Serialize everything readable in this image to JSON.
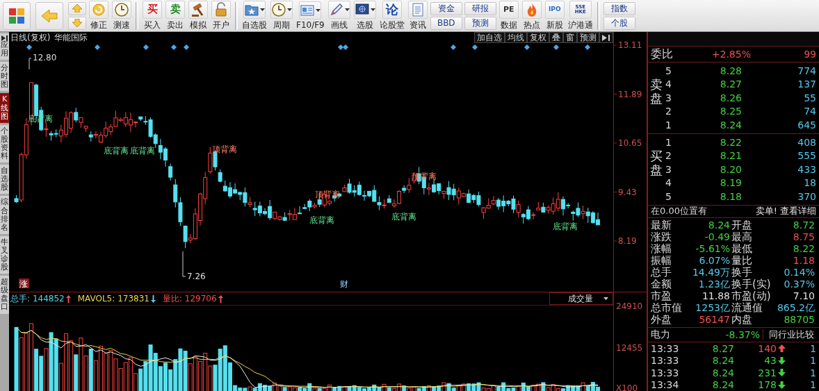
{
  "toolbar": [
    {
      "kind": "tile"
    },
    {
      "kind": "tile"
    },
    {
      "kind": "arrows"
    },
    {
      "kind": "button",
      "label": "修正"
    },
    {
      "kind": "button",
      "label": "测速"
    },
    {
      "kind": "separator"
    },
    {
      "kind": "button",
      "label": "买入",
      "glyph": "买"
    },
    {
      "kind": "button",
      "label": "卖出",
      "glyph": "卖"
    },
    {
      "kind": "button",
      "label": "模拟"
    },
    {
      "kind": "button",
      "label": "开户"
    },
    {
      "kind": "separator"
    },
    {
      "kind": "dropdown",
      "label": "自选股"
    },
    {
      "kind": "dropdown",
      "label": "周期"
    },
    {
      "kind": "dropdown",
      "label": "F10/F9"
    },
    {
      "kind": "dropdown",
      "label": "画线"
    },
    {
      "kind": "dropdown",
      "label": "选股"
    },
    {
      "kind": "button",
      "label": "论股堂",
      "glyph": "论"
    },
    {
      "kind": "button",
      "label": "资讯"
    },
    {
      "kind": "pair",
      "labels": [
        "资金",
        "BBD"
      ]
    },
    {
      "kind": "pair",
      "labels": [
        "研报",
        "预测"
      ]
    },
    {
      "kind": "button",
      "label": "数据",
      "glyph": "PE"
    },
    {
      "kind": "button",
      "label": "热点"
    },
    {
      "kind": "button",
      "label": "新股",
      "glyph": "IPO"
    },
    {
      "kind": "button",
      "label": "沪港通",
      "glyph": "SSE HKE"
    },
    {
      "kind": "separator"
    },
    {
      "kind": "pair",
      "labels": [
        "指数",
        "个股"
      ]
    }
  ],
  "side_tabs": [
    {
      "label": "应用",
      "selected": false
    },
    {
      "label": "分时图",
      "selected": false
    },
    {
      "label": "K线图",
      "selected": true
    },
    {
      "label": "个股资料",
      "selected": false
    },
    {
      "label": "自选股",
      "selected": false
    },
    {
      "label": "综合排名",
      "selected": false
    },
    {
      "label": "牛叉诊股",
      "selected": false
    },
    {
      "label": "超级盘口",
      "selected": false
    }
  ],
  "chart": {
    "period": "日线(复权)",
    "stock_name": "华能国际",
    "buttons": [
      "加自选",
      "均线",
      "复权",
      "叠",
      "窗",
      "预测"
    ],
    "price_ticks": [
      "13.11",
      "11.89",
      "10.65",
      "9.43",
      "8.19"
    ],
    "high_label": "12.80",
    "low_label": "7.26",
    "signals": [
      {
        "text": "底背离",
        "kind": "bottom"
      },
      {
        "text": "底背离",
        "kind": "bottom"
      },
      {
        "text": "底背离",
        "kind": "bottom"
      },
      {
        "text": "顶背离",
        "kind": "top"
      },
      {
        "text": "顶背离",
        "kind": "top"
      },
      {
        "text": "底背离",
        "kind": "bottom"
      },
      {
        "text": "底背离",
        "kind": "bottom"
      },
      {
        "text": "顶背离",
        "kind": "top"
      },
      {
        "text": "底背离",
        "kind": "bottom"
      }
    ],
    "tags": [
      {
        "text": "涨",
        "kind": "badge"
      },
      {
        "text": "财",
        "kind": "plain"
      }
    ]
  },
  "volume": {
    "readings": [
      {
        "label": "总手:",
        "value": "144852",
        "kind": "up",
        "color": "#55d8e8"
      },
      {
        "label": "MAVOL5:",
        "value": "173831",
        "kind": "down",
        "color": "#e8d850"
      },
      {
        "label": "量比:",
        "value": "129706",
        "kind": "up",
        "color": "#f05050"
      }
    ],
    "indicator": "成交量",
    "axis_ticks": [
      "24910",
      "12455",
      "X100"
    ]
  },
  "quote": {
    "ratio_label": "委比",
    "ratio_value": "+2.85%",
    "ratio_diff": "99",
    "asks_label": "卖盘",
    "asks": [
      {
        "level": "5",
        "price": "8.28",
        "volume": "774"
      },
      {
        "level": "4",
        "price": "8.27",
        "volume": "137"
      },
      {
        "level": "3",
        "price": "8.26",
        "volume": "55"
      },
      {
        "level": "2",
        "price": "8.25",
        "volume": "74"
      },
      {
        "level": "1",
        "price": "8.24",
        "volume": "645"
      }
    ],
    "bids_label": "买盘",
    "bids": [
      {
        "level": "1",
        "price": "8.22",
        "volume": "408"
      },
      {
        "level": "2",
        "price": "8.21",
        "volume": "555"
      },
      {
        "level": "3",
        "price": "8.20",
        "volume": "433"
      },
      {
        "level": "4",
        "price": "8.19",
        "volume": "18"
      },
      {
        "level": "5",
        "price": "8.18",
        "volume": "370"
      }
    ],
    "note": "在0.00位置有",
    "note_link": "卖单! 查看详细",
    "stats": [
      {
        "label": "最新",
        "value": "8.24",
        "color": "#44d044"
      },
      {
        "label": "开盘",
        "value": "8.72",
        "color": "#44d044"
      },
      {
        "label": "涨跌",
        "value": "-0.49",
        "color": "#44d044"
      },
      {
        "label": "最高",
        "value": "8.75",
        "color": "#f05050"
      },
      {
        "label": "涨幅",
        "value": "-5.61%",
        "color": "#44d044"
      },
      {
        "label": "最低",
        "value": "8.22",
        "color": "#44d044"
      },
      {
        "label": "振幅",
        "value": "6.07%",
        "color": "#55c8e8"
      },
      {
        "label": "量比",
        "value": "1.18",
        "color": "#f05050"
      },
      {
        "label": "总手",
        "value": "14.49万",
        "color": "#55c8e8"
      },
      {
        "label": "换手",
        "value": "0.14%",
        "color": "#55c8e8"
      },
      {
        "label": "金额",
        "value": "1.23亿",
        "color": "#55c8e8"
      },
      {
        "label": "换手(实)",
        "value": "0.37%",
        "color": "#55c8e8"
      },
      {
        "label": "市盈",
        "value": "11.88",
        "color": "#e0e0e0"
      },
      {
        "label": "市盈(动)",
        "value": "7.10",
        "color": "#e0e0e0"
      },
      {
        "label": "总市值",
        "value": "1253亿",
        "color": "#55c8e8"
      },
      {
        "label": "流通值",
        "value": "865.2亿",
        "color": "#55c8e8"
      },
      {
        "label": "外盘",
        "value": "56147",
        "color": "#f05050"
      },
      {
        "label": "内盘",
        "value": "88705",
        "color": "#44d044"
      }
    ],
    "sector": {
      "name": "电力",
      "change": "-8.37%",
      "button": "同行业比较"
    },
    "ticks": [
      {
        "time": "13:33",
        "price": "8.27",
        "volume": "140",
        "kind": "up",
        "count": "1"
      },
      {
        "time": "13:33",
        "price": "8.24",
        "volume": "43",
        "kind": "down",
        "count": "1"
      },
      {
        "time": "13:33",
        "price": "8.24",
        "volume": "231",
        "kind": "down",
        "count": "1"
      },
      {
        "time": "13:34",
        "price": "8.24",
        "volume": "178",
        "kind": "down",
        "count": "1"
      }
    ]
  }
}
